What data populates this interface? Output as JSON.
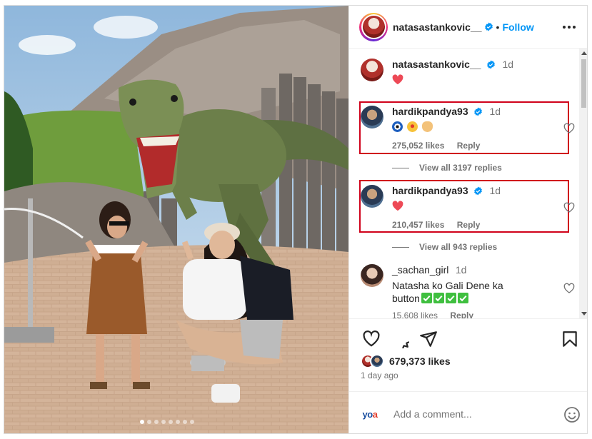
{
  "post": {
    "author": "natasastankovic__",
    "follow_label": "Follow",
    "separator": "•",
    "caption_age": "1d",
    "likes": "679,373 likes",
    "time_ago": "1 day ago",
    "photo_dots": 8,
    "active_dot": 0
  },
  "comments": [
    {
      "username": "hardikpandya93",
      "age": "1d",
      "text_emoji_names": [
        "nazar-amulet",
        "star-struck",
        "ok-hand"
      ],
      "likes": "275,052 likes",
      "reply_label": "Reply",
      "view_replies": "View all 3197 replies"
    },
    {
      "username": "hardikpandya93",
      "age": "1d",
      "text_emoji_names": [
        "red-heart"
      ],
      "likes": "210,457 likes",
      "reply_label": "Reply",
      "view_replies": "View all 943 replies"
    },
    {
      "username": "_sachan_girl",
      "age": "1d",
      "text_line1": "Natasha ko Gali Dene ka",
      "text_line2": "button",
      "text_emoji_names": [
        "check-mark",
        "check-mark",
        "check-mark",
        "check-mark"
      ],
      "likes": "15,608 likes",
      "reply_label": "Reply"
    }
  ],
  "add_comment": {
    "placeholder": "Add a comment...",
    "logo_text_a": "yo",
    "logo_text_b": "a"
  },
  "colors": {
    "accent": "#0095f6",
    "highlight_box": "#d0021b",
    "heart": "#ed4956",
    "check_green": "#3fbf3f"
  }
}
